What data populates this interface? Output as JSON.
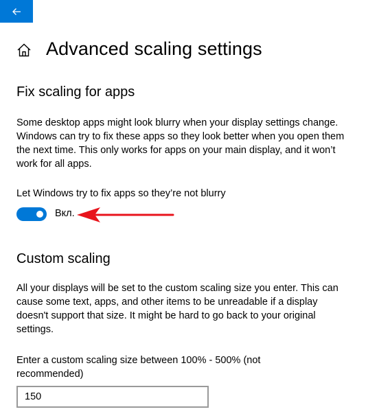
{
  "nav": {
    "back_icon": "arrow-left-icon",
    "home_icon": "home-icon"
  },
  "page": {
    "title": "Advanced scaling settings"
  },
  "fix_scaling": {
    "title": "Fix scaling for apps",
    "description": "Some desktop apps might look blurry when your display settings change. Windows can try to fix these apps so they look better when you open them the next time. This only works for apps on your main display, and it won’t work for all apps.",
    "toggle_label": "Let Windows try to fix apps so they’re not blurry",
    "toggle_state": "Вкл.",
    "toggle_on": true
  },
  "custom_scaling": {
    "title": "Custom scaling",
    "description": "All your displays will be set to the custom scaling size you enter. This can cause some text, apps, and other items to be unreadable if a display doesn't support that size. It might be hard to go back to your original settings.",
    "input_label": "Enter a custom scaling size between 100% - 500% (not recommended)",
    "input_value": "150"
  },
  "colors": {
    "accent": "#0078d7",
    "annotation_arrow": "#e8141c"
  }
}
